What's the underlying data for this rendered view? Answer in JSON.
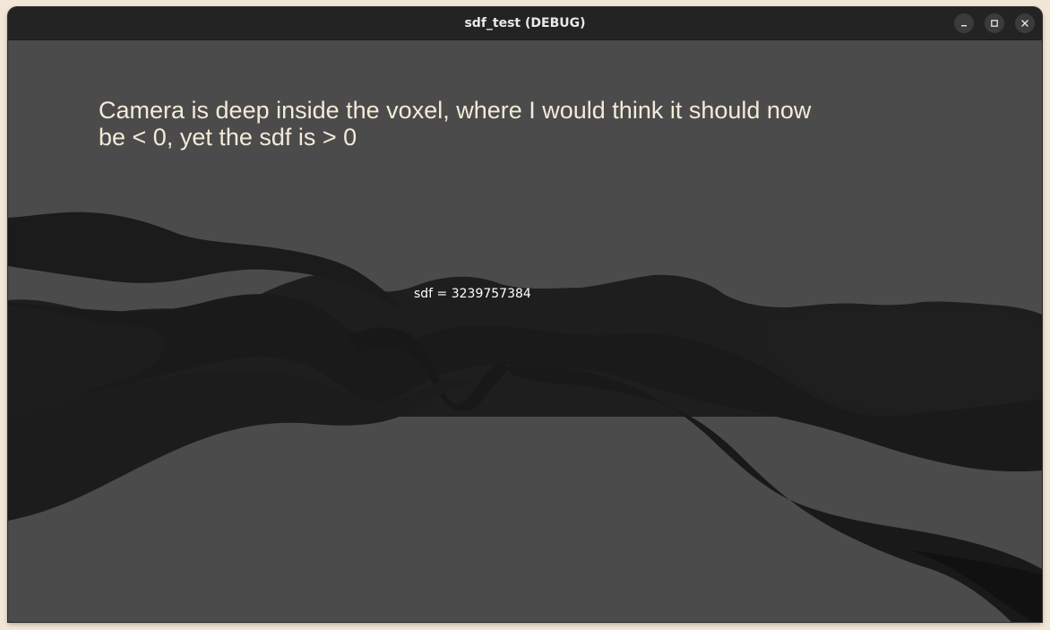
{
  "window": {
    "title": "sdf_test (DEBUG)",
    "controls": {
      "minimize_icon": "minimize-icon",
      "maximize_icon": "maximize-icon",
      "close_icon": "close-icon"
    }
  },
  "viewport": {
    "caption": "Camera is deep inside the voxel, where I would think it should now be < 0, yet the sdf is > 0",
    "sdf_readout": "sdf = 3239757384",
    "colors": {
      "background": "#4b4b4b",
      "terrain": "#1c1c1c",
      "caption_text": "#f3ead8",
      "readout_text": "#ffffff"
    }
  }
}
